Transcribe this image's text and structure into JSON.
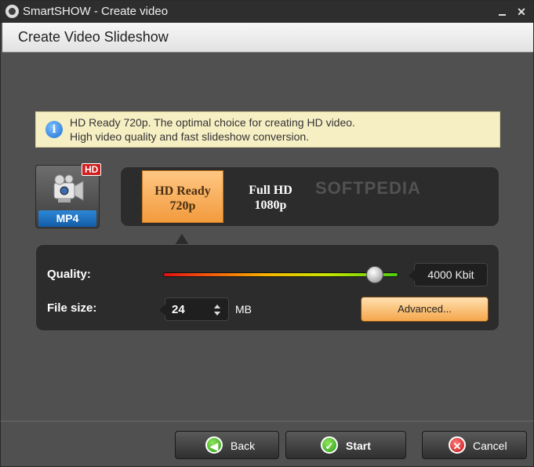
{
  "window": {
    "title": "SmartSHOW - Create video",
    "minimize_icon": "minimize-icon",
    "close_glyph": "✕"
  },
  "header": {
    "title": "Create Video Slideshow"
  },
  "info": {
    "icon_glyph": "i",
    "line1": "HD Ready 720p. The optimal choice for creating HD video.",
    "line2": "High video quality and fast slideshow conversion."
  },
  "format": {
    "badge": "HD",
    "label": "MP4",
    "icon": "camcorder-icon"
  },
  "resolutions": [
    {
      "name": "HD Ready",
      "value": "720p",
      "selected": true
    },
    {
      "name": "Full HD",
      "value": "1080p",
      "selected": false
    }
  ],
  "watermark": "SOFTPEDIA",
  "settings": {
    "quality_label": "Quality:",
    "quality_value": "4000 Kbit",
    "quality_fraction": 0.9,
    "filesize_label": "File size:",
    "filesize_value": "24",
    "filesize_unit": "MB",
    "advanced_label": "Advanced..."
  },
  "footer": {
    "back_label": "Back",
    "start_label": "Start",
    "cancel_label": "Cancel"
  },
  "colors": {
    "accent_orange": "#f29b3e",
    "mp4_blue": "#1f74c4",
    "hd_red": "#d21c1c",
    "ok_green": "#2c9a1e",
    "cancel_red": "#c41515"
  }
}
